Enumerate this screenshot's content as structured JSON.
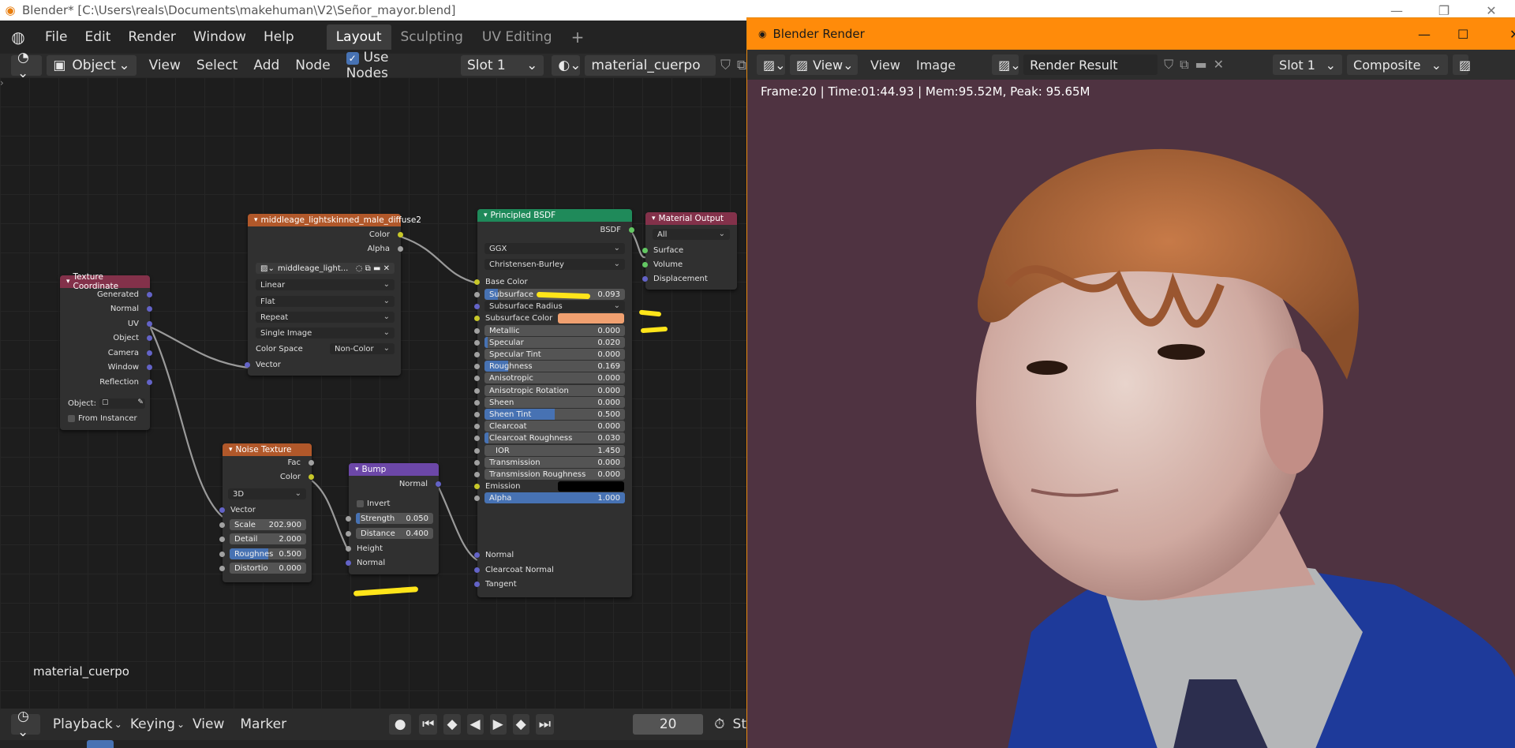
{
  "window_title": "Blender* [C:\\Users\\reals\\Documents\\makehuman\\V2\\Señor_mayor.blend]",
  "menu": [
    "File",
    "Edit",
    "Render",
    "Window",
    "Help"
  ],
  "workspaces": [
    "Layout",
    "Sculpting",
    "UV Editing"
  ],
  "header": {
    "mode": "Object",
    "view": "View",
    "select": "Select",
    "add": "Add",
    "node": "Node",
    "use_nodes": "Use Nodes",
    "slot": "Slot 1",
    "material": "material_cuerpo"
  },
  "canvas_label": "material_cuerpo",
  "nodes": {
    "texcoord": {
      "title": "Texture Coordinate",
      "outputs": [
        "Generated",
        "Normal",
        "UV",
        "Object",
        "Camera",
        "Window",
        "Reflection"
      ],
      "object_label": "Object:",
      "from_instancer": "From Instancer"
    },
    "image": {
      "title": "middleage_lightskinned_male_diffuse2",
      "outputs": [
        "Color",
        "Alpha"
      ],
      "image_name": "middleage_light...",
      "interpolation": "Linear",
      "projection": "Flat",
      "extension": "Repeat",
      "source": "Single Image",
      "colorspace_label": "Color Space",
      "colorspace": "Non-Color",
      "input": "Vector"
    },
    "noise": {
      "title": "Noise Texture",
      "outputs": [
        "Fac",
        "Color"
      ],
      "dim": "3D",
      "vector": "Vector",
      "fields": [
        {
          "l": "Scale",
          "v": "202.900"
        },
        {
          "l": "Detail",
          "v": "2.000"
        },
        {
          "l": "Roughnes",
          "v": "0.500"
        },
        {
          "l": "Distortio",
          "v": "0.000"
        }
      ]
    },
    "bump": {
      "title": "Bump",
      "output": "Normal",
      "invert": "Invert",
      "fields": [
        {
          "l": "Strength",
          "v": "0.050"
        },
        {
          "l": "Distance",
          "v": "0.400"
        }
      ],
      "inputs": [
        "Height",
        "Normal"
      ]
    },
    "bsdf": {
      "title": "Principled BSDF",
      "output": "BSDF",
      "distribution": "GGX",
      "sss_method": "Christensen-Burley",
      "base_color": "Base Color",
      "fields": [
        {
          "l": "Subsurface",
          "v": "0.093",
          "f": 0.093
        },
        {
          "l": "Subsurface Radius",
          "v": ""
        },
        {
          "l": "Subsurface Color",
          "v": ""
        },
        {
          "l": "Metallic",
          "v": "0.000",
          "f": 0
        },
        {
          "l": "Specular",
          "v": "0.020",
          "f": 0.02
        },
        {
          "l": "Specular Tint",
          "v": "0.000",
          "f": 0
        },
        {
          "l": "Roughness",
          "v": "0.169",
          "f": 0.169
        },
        {
          "l": "Anisotropic",
          "v": "0.000",
          "f": 0
        },
        {
          "l": "Anisotropic Rotation",
          "v": "0.000",
          "f": 0
        },
        {
          "l": "Sheen",
          "v": "0.000",
          "f": 0
        },
        {
          "l": "Sheen Tint",
          "v": "0.500",
          "f": 0.5
        },
        {
          "l": "Clearcoat",
          "v": "0.000",
          "f": 0
        },
        {
          "l": "Clearcoat Roughness",
          "v": "0.030",
          "f": 0.03
        },
        {
          "l": "IOR",
          "v": "1.450",
          "f": 0
        },
        {
          "l": "Transmission",
          "v": "0.000",
          "f": 0
        },
        {
          "l": "Transmission Roughness",
          "v": "0.000",
          "f": 0
        },
        {
          "l": "Emission",
          "v": ""
        },
        {
          "l": "Alpha",
          "v": "1.000",
          "f": 1
        }
      ],
      "inputs": [
        "Normal",
        "Clearcoat Normal",
        "Tangent"
      ],
      "subsurface_color": "#f0a070",
      "emission_color": "#000000"
    },
    "output": {
      "title": "Material Output",
      "target": "All",
      "inputs": [
        "Surface",
        "Volume",
        "Displacement"
      ]
    }
  },
  "timeline": {
    "playback": "Playback",
    "keying": "Keying",
    "view": "View",
    "marker": "Marker",
    "frame": "20",
    "start": "St"
  },
  "render": {
    "title": "Blender Render",
    "view": "View",
    "view2": "View",
    "image": "Image",
    "result": "Render Result",
    "slot": "Slot 1",
    "pass": "Composite",
    "info": "Frame:20 | Time:01:44.93 | Mem:95.52M, Peak: 95.65M"
  },
  "colors": {
    "accent": "#4772b3",
    "render_title_bar": "#ff8b0a",
    "highlight": "#ffe51a",
    "render_bg": "#4f3341"
  }
}
